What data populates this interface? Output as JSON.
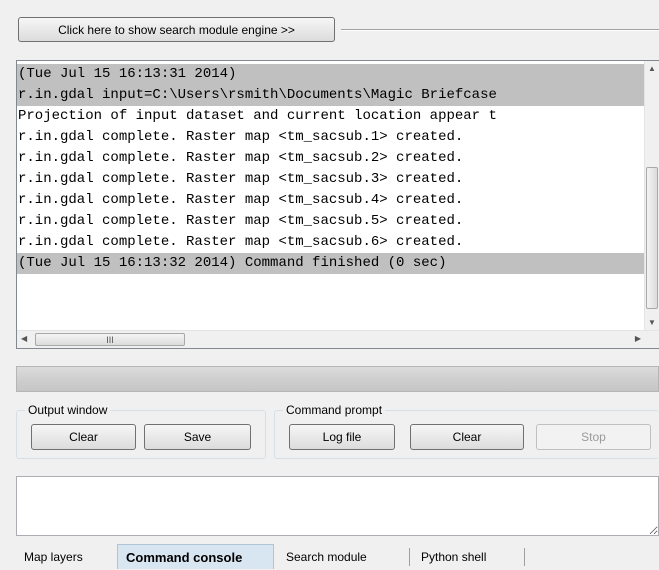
{
  "toolbar": {
    "search_module_button": "Click here to show search module engine >>"
  },
  "output_log": {
    "lines": [
      {
        "text": "(Tue Jul 15 16:13:31 2014)",
        "highlighted": true
      },
      {
        "text": "r.in.gdal input=C:\\Users\\rsmith\\Documents\\Magic Briefcase",
        "highlighted": true
      },
      {
        "text": "Projection of input dataset and current location appear t",
        "highlighted": false
      },
      {
        "text": "r.in.gdal complete. Raster map <tm_sacsub.1> created.",
        "highlighted": false
      },
      {
        "text": "r.in.gdal complete. Raster map <tm_sacsub.2> created.",
        "highlighted": false
      },
      {
        "text": "r.in.gdal complete. Raster map <tm_sacsub.3> created.",
        "highlighted": false
      },
      {
        "text": "r.in.gdal complete. Raster map <tm_sacsub.4> created.",
        "highlighted": false
      },
      {
        "text": "r.in.gdal complete. Raster map <tm_sacsub.5> created.",
        "highlighted": false
      },
      {
        "text": "r.in.gdal complete. Raster map <tm_sacsub.6> created.",
        "highlighted": false
      },
      {
        "text": "(Tue Jul 15 16:13:32 2014) Command finished (0 sec)",
        "highlighted": true
      }
    ],
    "hscroll_thumb_glyph": "III"
  },
  "output_window": {
    "title": "Output window",
    "clear_label": "Clear",
    "save_label": "Save"
  },
  "command_prompt": {
    "title": "Command prompt",
    "logfile_label": "Log file",
    "clear_label": "Clear",
    "stop_label": "Stop",
    "input_value": ""
  },
  "tabs": [
    {
      "label": "Map layers",
      "active": false
    },
    {
      "label": "Command console",
      "active": true
    },
    {
      "label": "Search module",
      "active": false
    },
    {
      "label": "Python shell",
      "active": false
    }
  ],
  "colors": {
    "log_highlight": "#c0c0c0",
    "active_tab": "#d8e6f2",
    "window_bg": "#f0f0f0"
  },
  "icons": {
    "scroll_up": "scroll-up-arrow-icon",
    "scroll_down": "scroll-down-arrow-icon",
    "scroll_left": "scroll-left-arrow-icon",
    "scroll_right": "scroll-right-arrow-icon"
  }
}
